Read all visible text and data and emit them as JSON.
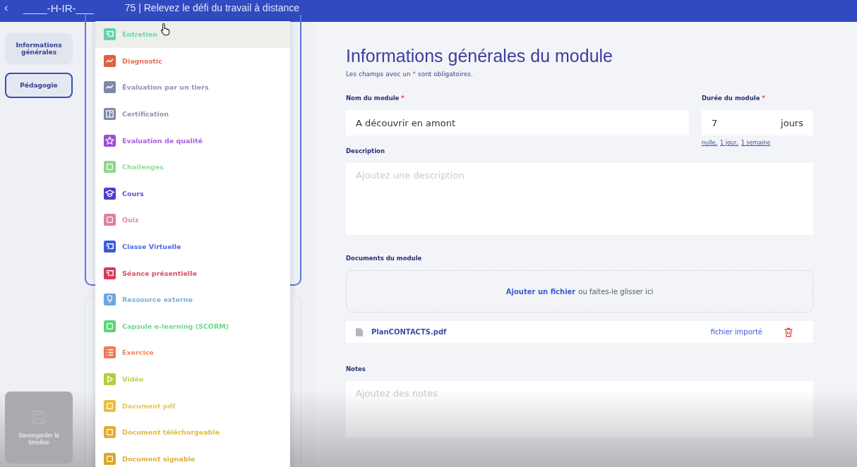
{
  "header": {
    "back": "‹",
    "code": "____-H-IR-___",
    "title": "75 | Relevez le défi du travail à distance"
  },
  "sidebar": {
    "items": [
      {
        "label": "Informations générales",
        "selected": false
      },
      {
        "label": "Pédagogie",
        "selected": true
      }
    ],
    "save_button": {
      "label": "Sauvegarder la timeline",
      "disabled": true
    }
  },
  "activity_menu": {
    "items": [
      {
        "label": "Entretien",
        "color": "#5fd3b0",
        "kind": "board",
        "selected": true
      },
      {
        "label": "Diagnostic",
        "color": "#e0603f",
        "kind": "trend",
        "selected": false
      },
      {
        "label": "Évaluation par un tiers",
        "color": "#7f88a8",
        "kind": "trend",
        "selected": false
      },
      {
        "label": "Certification",
        "color": "#7f88a8",
        "kind": "doc",
        "selected": false
      },
      {
        "label": "Evaluation de qualité",
        "color": "#9b4fd6",
        "kind": "star",
        "selected": false
      },
      {
        "label": "Challenges",
        "color": "#8fd68f",
        "kind": "square",
        "selected": false
      },
      {
        "label": "Cours",
        "color": "#4a3fd0",
        "kind": "cap",
        "selected": false
      },
      {
        "label": "Quiz",
        "color": "#e07fa0",
        "kind": "square",
        "selected": false
      },
      {
        "label": "Classe Virtuelle",
        "color": "#3a5be0",
        "kind": "board",
        "selected": false
      },
      {
        "label": "Séance présentielle",
        "color": "#d83a5a",
        "kind": "board",
        "selected": false
      },
      {
        "label": "Ressource externe",
        "color": "#6aa8e0",
        "kind": "bulb",
        "selected": false
      },
      {
        "label": "Capsule e-learning (SCORM)",
        "color": "#5fd37a",
        "kind": "square",
        "selected": false
      },
      {
        "label": "Exercice",
        "color": "#f07a50",
        "kind": "list",
        "selected": false
      },
      {
        "label": "Vidéo",
        "color": "#b8cc3a",
        "kind": "play",
        "selected": false
      },
      {
        "label": "Document pdf",
        "color": "#e8c040",
        "kind": "square",
        "selected": false
      },
      {
        "label": "Document téléchargeable",
        "color": "#e0b030",
        "kind": "square",
        "selected": false
      },
      {
        "label": "Document signable",
        "color": "#d8a828",
        "kind": "square",
        "selected": false
      }
    ]
  },
  "form": {
    "title": "Informations générales du module",
    "note": "Les champs avec un * sont obligatoires.",
    "name_label": "Nom du module",
    "name_mark": "*",
    "duration_mark": "*",
    "name_value": "A découvrir en amont",
    "duration_label": "Durée du module",
    "duration_value": "7",
    "duration_unit": "jours",
    "duration_shortcuts": [
      "nulle,",
      "1 jour,",
      "1 semaine"
    ],
    "description_label": "Description",
    "description_placeholder": "Ajoutez une description",
    "documents_label": "Documents du module",
    "upload_link": "Ajouter un fichier",
    "upload_text": "ou faites-le glisser ici",
    "files": [
      {
        "name": "PlanCONTACTS.pdf",
        "status": "fichier importé"
      }
    ],
    "notes_label": "Notes",
    "notes_placeholder": "Ajoutez des notes"
  }
}
